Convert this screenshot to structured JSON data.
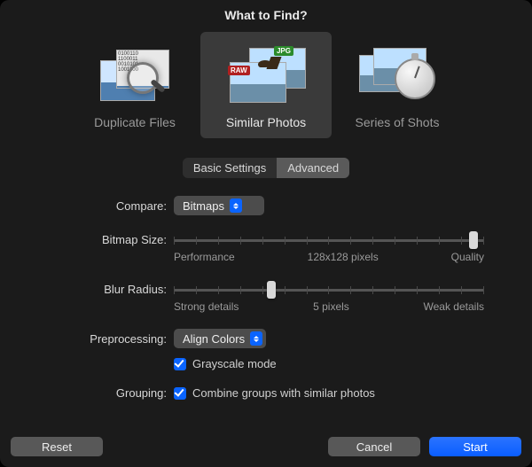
{
  "window": {
    "title": "What to Find?"
  },
  "modes": [
    {
      "id": "duplicate-files",
      "label": "Duplicate Files",
      "selected": false
    },
    {
      "id": "similar-photos",
      "label": "Similar Photos",
      "selected": true
    },
    {
      "id": "series-of-shots",
      "label": "Series of Shots",
      "selected": false
    }
  ],
  "settings_tabs": {
    "basic": "Basic Settings",
    "advanced": "Advanced",
    "selected": "advanced"
  },
  "compare": {
    "label": "Compare:",
    "value": "Bitmaps"
  },
  "bitmap_size": {
    "label": "Bitmap Size:",
    "left": "Performance",
    "mid": "128x128 pixels",
    "right": "Quality",
    "value_pct": 98
  },
  "blur_radius": {
    "label": "Blur Radius:",
    "left": "Strong details",
    "mid": "5 pixels",
    "right": "Weak details",
    "value_pct": 31
  },
  "preprocessing": {
    "label": "Preprocessing:",
    "value": "Align Colors",
    "grayscale_label": "Grayscale mode",
    "grayscale_checked": true
  },
  "grouping": {
    "label": "Grouping:",
    "combine_label": "Combine groups with similar photos",
    "combine_checked": true
  },
  "buttons": {
    "reset": "Reset",
    "cancel": "Cancel",
    "start": "Start"
  }
}
